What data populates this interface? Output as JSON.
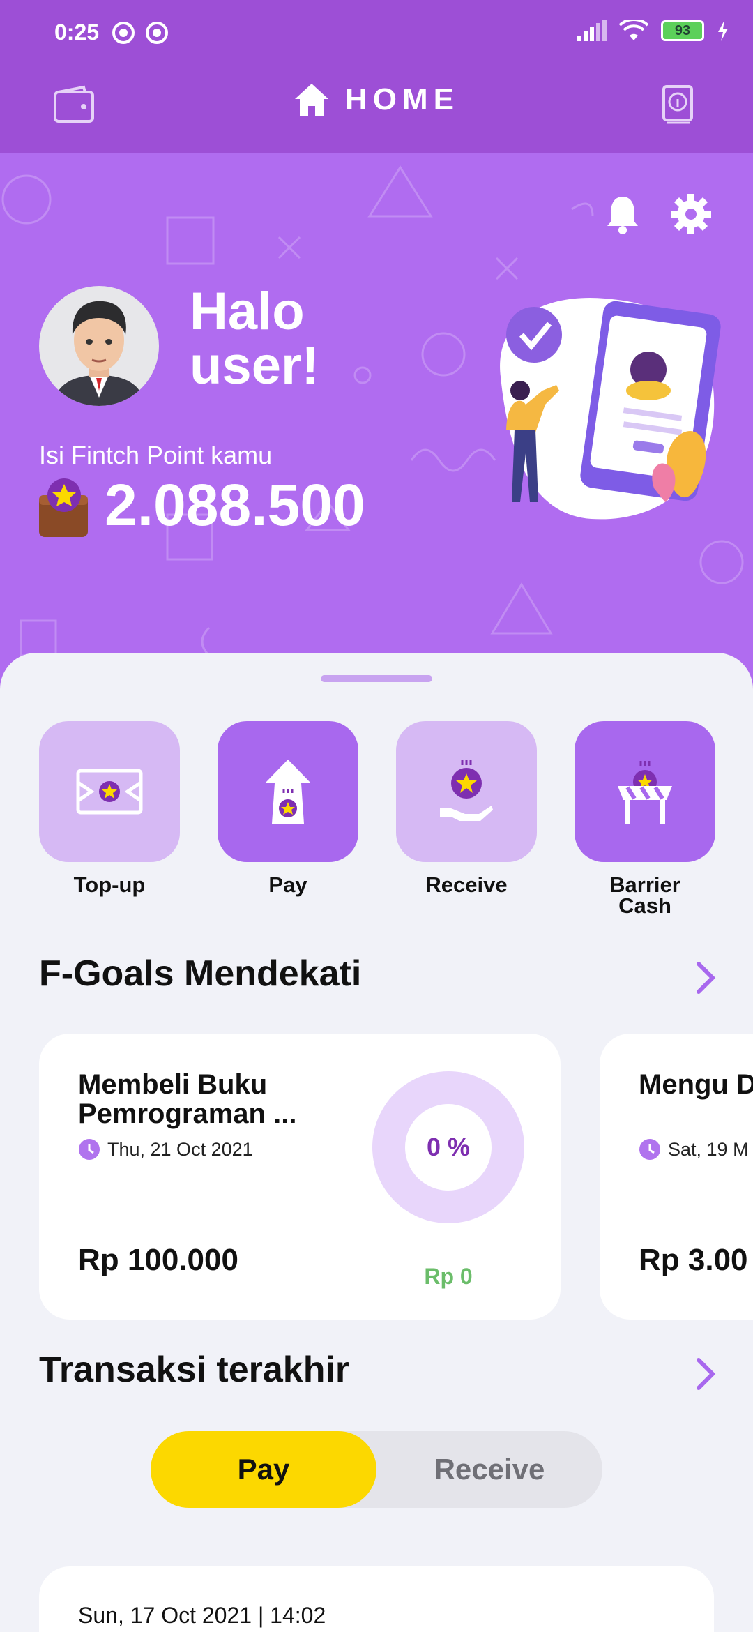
{
  "status_bar": {
    "time": "0:25",
    "battery": "93"
  },
  "header": {
    "title": "HOME",
    "wallet_icon": "wallet-icon",
    "info_icon": "info-book-icon"
  },
  "hero": {
    "greeting": "Halo user!",
    "point_label": "Isi Fintch Point kamu",
    "point_value": "2.088.500"
  },
  "actions": [
    {
      "label": "Top-up",
      "icon": "topup-banknote-icon"
    },
    {
      "label": "Pay",
      "icon": "pay-arrow-icon"
    },
    {
      "label": "Receive",
      "icon": "receive-hand-icon"
    },
    {
      "label": "Barrier Cash",
      "icon": "barrier-cash-icon"
    }
  ],
  "goals": {
    "title": "F-Goals Mendekati",
    "items": [
      {
        "title": "Membeli Buku Pemrograman ...",
        "date": "Thu, 21 Oct 2021",
        "amount": "Rp 100.000",
        "percent_label": "0 %",
        "saved": "Rp 0",
        "progress": 0
      },
      {
        "title": "Mengu Dana D",
        "date": "Sat, 19 M",
        "amount": "Rp 3.00"
      }
    ]
  },
  "transactions": {
    "title": "Transaksi terakhir",
    "tabs": [
      "Pay",
      "Receive"
    ],
    "active_tab": "Pay",
    "latest": {
      "datetime": "Sun, 17 Oct 2021 | 14:02"
    }
  },
  "colors": {
    "topbar": "#9d4fd6",
    "hero": "#b06cf0",
    "tile_light": "#d6b9f4",
    "tile_dark": "#a868ee",
    "toggle_active": "#fcd800",
    "saved_green": "#6bbd6a"
  }
}
